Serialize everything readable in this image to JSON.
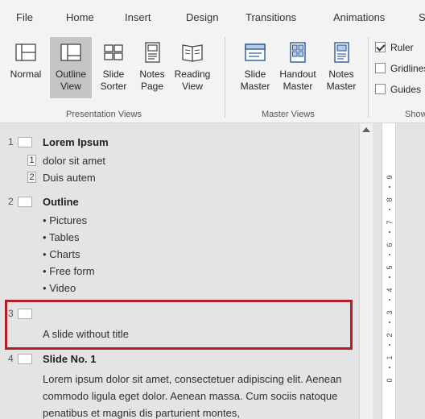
{
  "menu": {
    "tabs": [
      "File",
      "Home",
      "Insert",
      "Design",
      "Transitions",
      "Animations",
      "S"
    ]
  },
  "ribbon": {
    "presentation_views": {
      "label": "Presentation Views",
      "buttons": [
        {
          "line1": "Normal",
          "line2": "",
          "icon": "normal-view-icon",
          "selected": false
        },
        {
          "line1": "Outline",
          "line2": "View",
          "icon": "outline-view-icon",
          "selected": true
        },
        {
          "line1": "Slide",
          "line2": "Sorter",
          "icon": "slide-sorter-icon",
          "selected": false
        },
        {
          "line1": "Notes",
          "line2": "Page",
          "icon": "notes-page-icon",
          "selected": false
        },
        {
          "line1": "Reading",
          "line2": "View",
          "icon": "reading-view-icon",
          "selected": false
        }
      ]
    },
    "master_views": {
      "label": "Master Views",
      "buttons": [
        {
          "line1": "Slide",
          "line2": "Master",
          "icon": "slide-master-icon"
        },
        {
          "line1": "Handout",
          "line2": "Master",
          "icon": "handout-master-icon"
        },
        {
          "line1": "Notes",
          "line2": "Master",
          "icon": "notes-master-icon"
        }
      ]
    },
    "show": {
      "label": "Show",
      "checkboxes": [
        {
          "label": "Ruler",
          "checked": true
        },
        {
          "label": "Gridlines",
          "checked": false
        },
        {
          "label": "Guides",
          "checked": false
        }
      ]
    }
  },
  "outline": {
    "slides": [
      {
        "num": "1",
        "title": "Lorem Ipsum",
        "subs": [
          {
            "num": "1",
            "text": "dolor sit amet"
          },
          {
            "num": "2",
            "text": "Duis autem"
          }
        ]
      },
      {
        "num": "2",
        "title": "Outline",
        "bullets": [
          "Pictures",
          "Tables",
          "Charts",
          "Free form",
          "Video"
        ]
      },
      {
        "num": "3",
        "title": "",
        "body": "A slide without title"
      },
      {
        "num": "4",
        "title": "Slide No. 1",
        "paragraph": "Lorem ipsum dolor sit amet, consectetuer adipiscing elit. Aenean commodo ligula eget dolor. Aenean massa. Cum sociis natoque penatibus et magnis dis parturient montes,"
      }
    ],
    "bullet_char": "•"
  },
  "ruler": {
    "numbers": [
      "9",
      "8",
      "7",
      "6",
      "5",
      "4",
      "3",
      "2",
      "1",
      "0"
    ]
  },
  "colors": {
    "highlight": "#b01f24",
    "selected_button": "#c5c5c5"
  }
}
